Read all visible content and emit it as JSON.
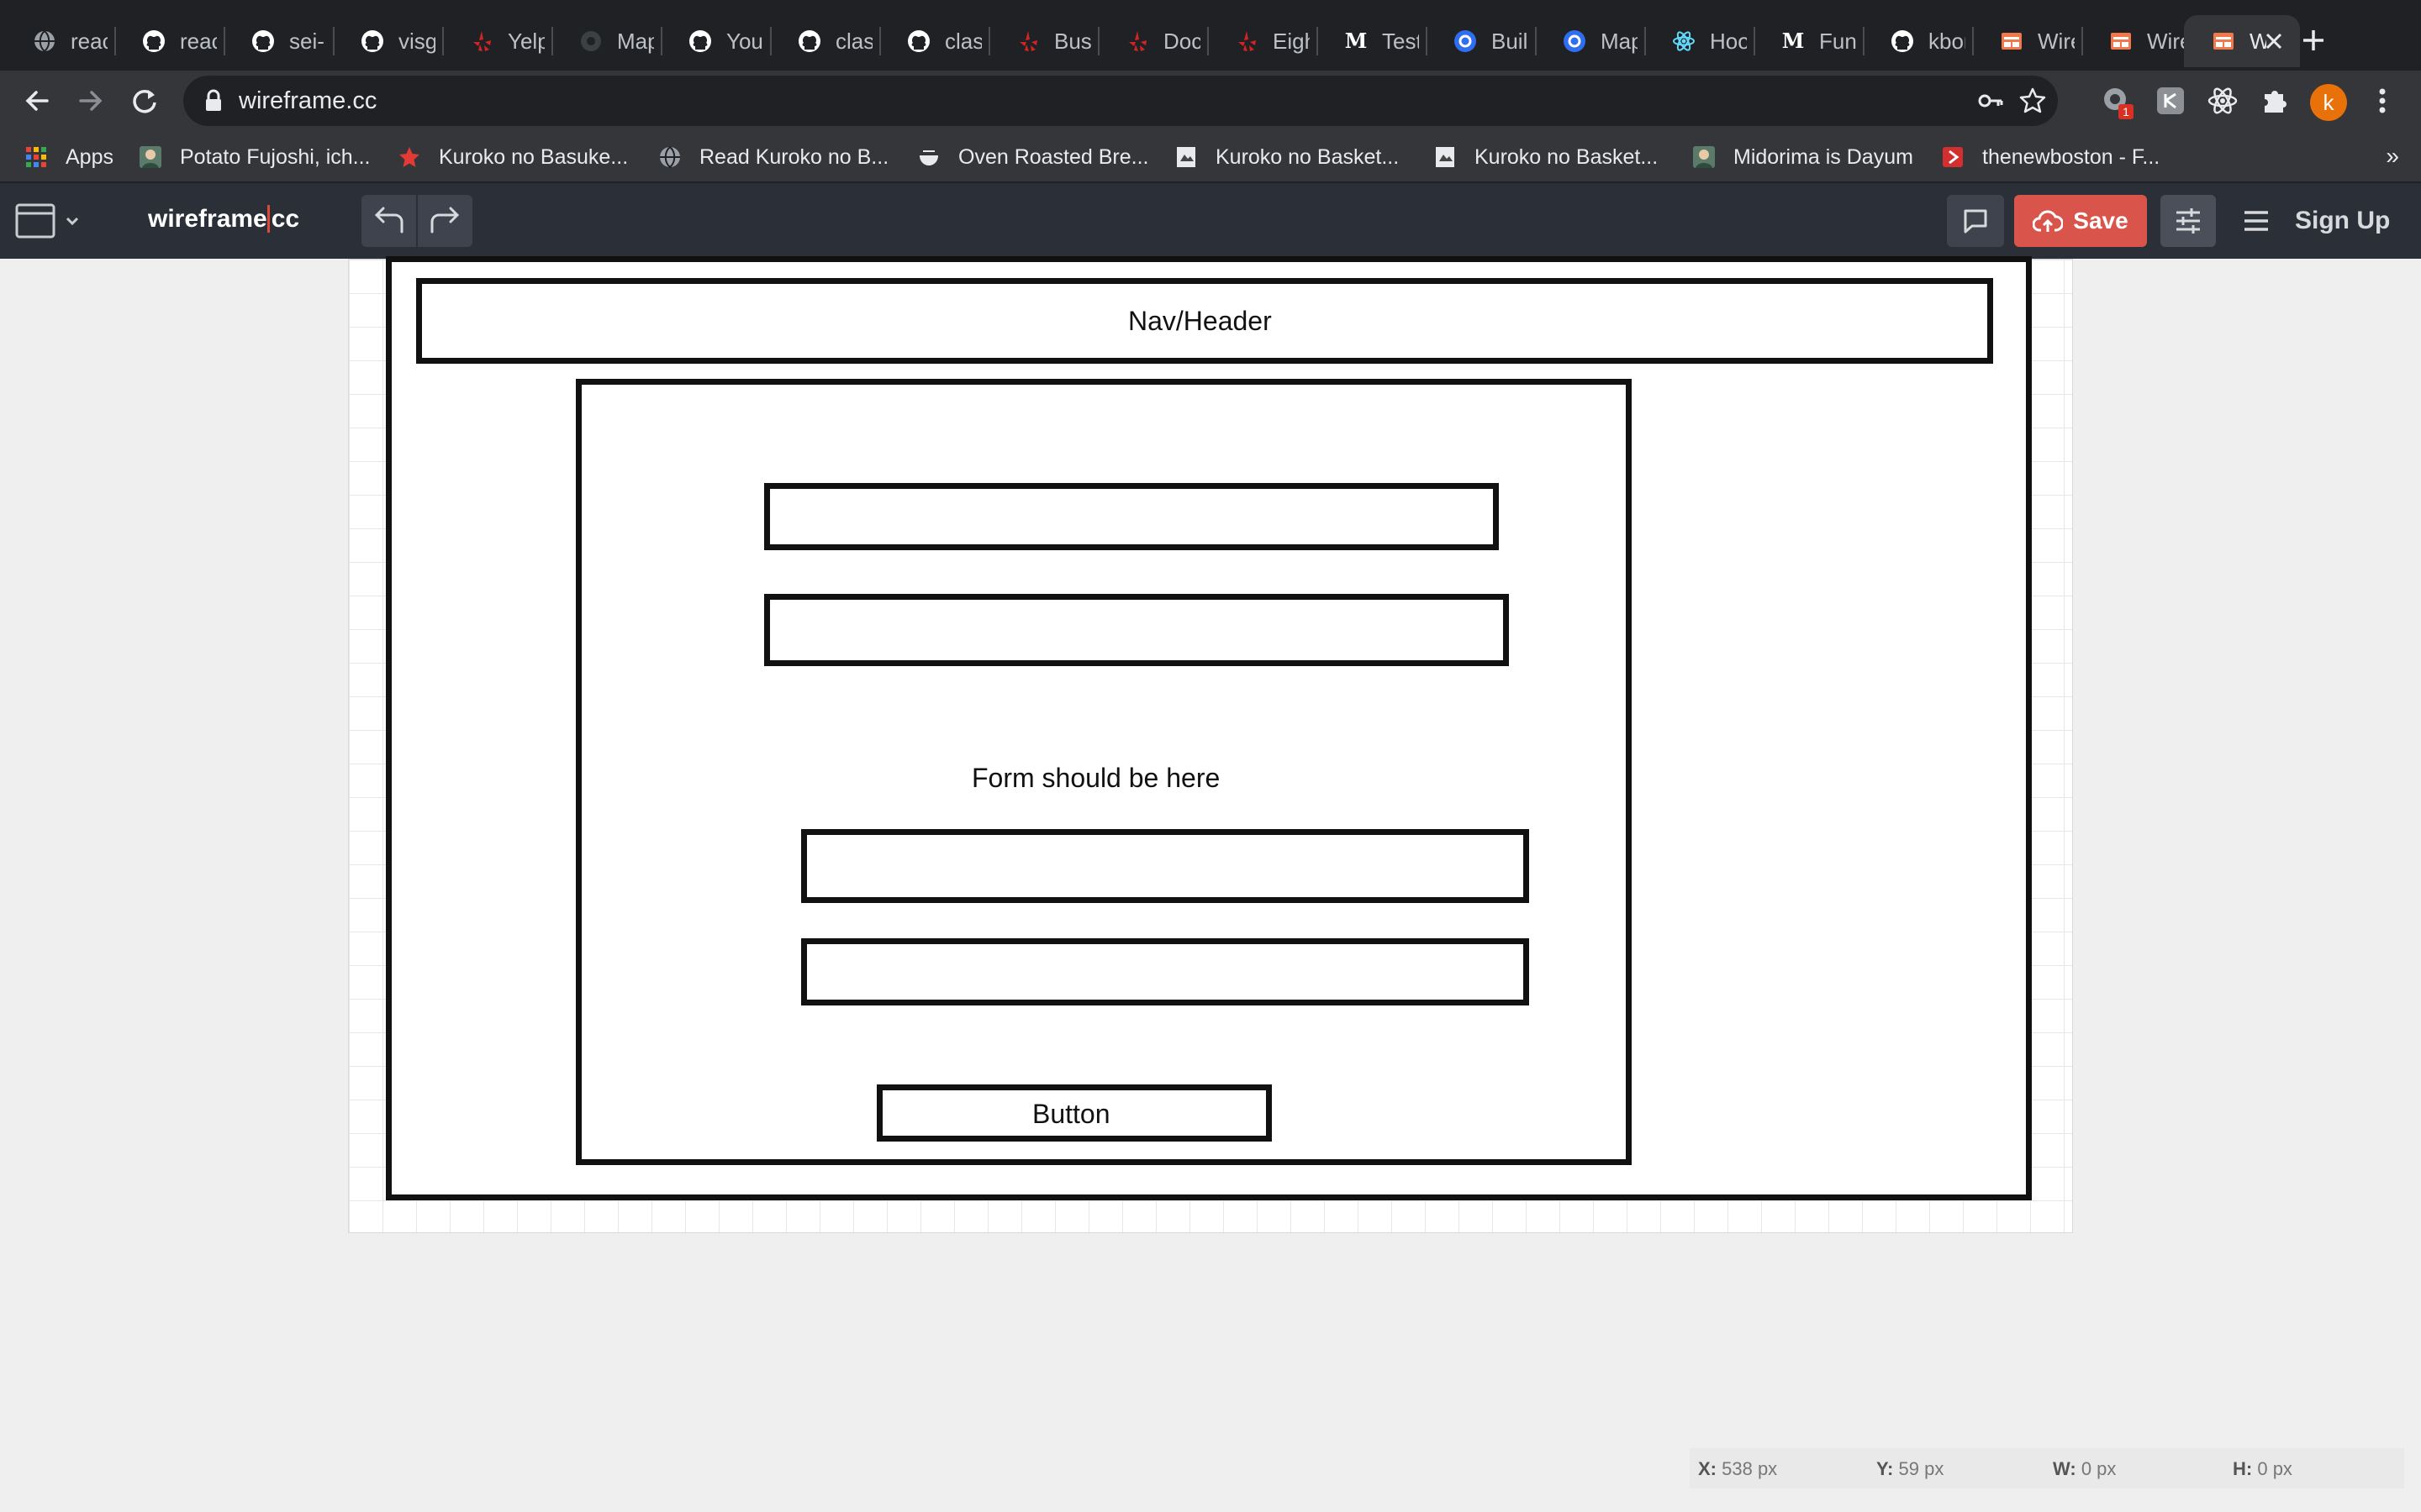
{
  "browser": {
    "tabs": [
      {
        "title": "reac",
        "icon": "globe-icon"
      },
      {
        "title": "reac",
        "icon": "github-icon"
      },
      {
        "title": "sei-",
        "icon": "github-icon"
      },
      {
        "title": "visg",
        "icon": "github-icon"
      },
      {
        "title": "Yelp",
        "icon": "yelp-icon"
      },
      {
        "title": "Map",
        "icon": "map-icon"
      },
      {
        "title": "Your",
        "icon": "github-icon"
      },
      {
        "title": "clas",
        "icon": "github-icon"
      },
      {
        "title": "clas",
        "icon": "github-icon"
      },
      {
        "title": "Busi",
        "icon": "yelp-icon"
      },
      {
        "title": "Doc",
        "icon": "yelp-icon"
      },
      {
        "title": "Eigh",
        "icon": "yelp-icon"
      },
      {
        "title": "Test",
        "icon": "medium-icon"
      },
      {
        "title": "Buil",
        "icon": "blue-circle-icon"
      },
      {
        "title": "Map",
        "icon": "blue-circle-icon"
      },
      {
        "title": "Hoo",
        "icon": "react-icon"
      },
      {
        "title": "Func",
        "icon": "medium-icon"
      },
      {
        "title": "kbor",
        "icon": "github-icon"
      },
      {
        "title": "Wire",
        "icon": "wireframe-icon"
      },
      {
        "title": "Wire",
        "icon": "wireframe-icon"
      },
      {
        "title": "W",
        "icon": "wireframe-icon",
        "active": true
      }
    ],
    "url": "wireframe.cc",
    "profile_initial": "k",
    "extension_badge": "1",
    "bookmarks": [
      {
        "label": "Apps",
        "icon": "apps-grid-icon"
      },
      {
        "label": "Potato Fujoshi, ich...",
        "icon": "avatar-icon"
      },
      {
        "label": "Kuroko no Basuke...",
        "icon": "star-icon"
      },
      {
        "label": "Read Kuroko no B...",
        "icon": "globe-icon"
      },
      {
        "label": "Oven Roasted Bre...",
        "icon": "bowl-icon"
      },
      {
        "label": "Kuroko no Basket...",
        "icon": "page-icon"
      },
      {
        "label": "Kuroko no Basket...",
        "icon": "page-icon"
      },
      {
        "label": "Midorima is Dayum",
        "icon": "avatar-icon"
      },
      {
        "label": "thenewboston - F...",
        "icon": "play-icon"
      }
    ],
    "more_bookmarks": "»"
  },
  "app": {
    "logo_main": "wireframe",
    "logo_suffix": "cc",
    "save_label": "Save",
    "signup_label": "Sign Up"
  },
  "wireframe": {
    "header_label": "Nav/Header",
    "form_label": "Form should be here",
    "button_label": "Button"
  },
  "status": {
    "x_label": "X:",
    "x_value": "538 px",
    "y_label": "Y:",
    "y_value": "59 px",
    "w_label": "W:",
    "w_value": "0 px",
    "h_label": "H:",
    "h_value": "0 px"
  },
  "colors": {
    "tabstrip": "#202124",
    "toolbar": "#35363a",
    "appbar": "#2b2f38",
    "save": "#d9544a",
    "github": "#ffffff",
    "yelp": "#d32323",
    "react": "#61dafb",
    "wireframe": "#f0784a"
  }
}
